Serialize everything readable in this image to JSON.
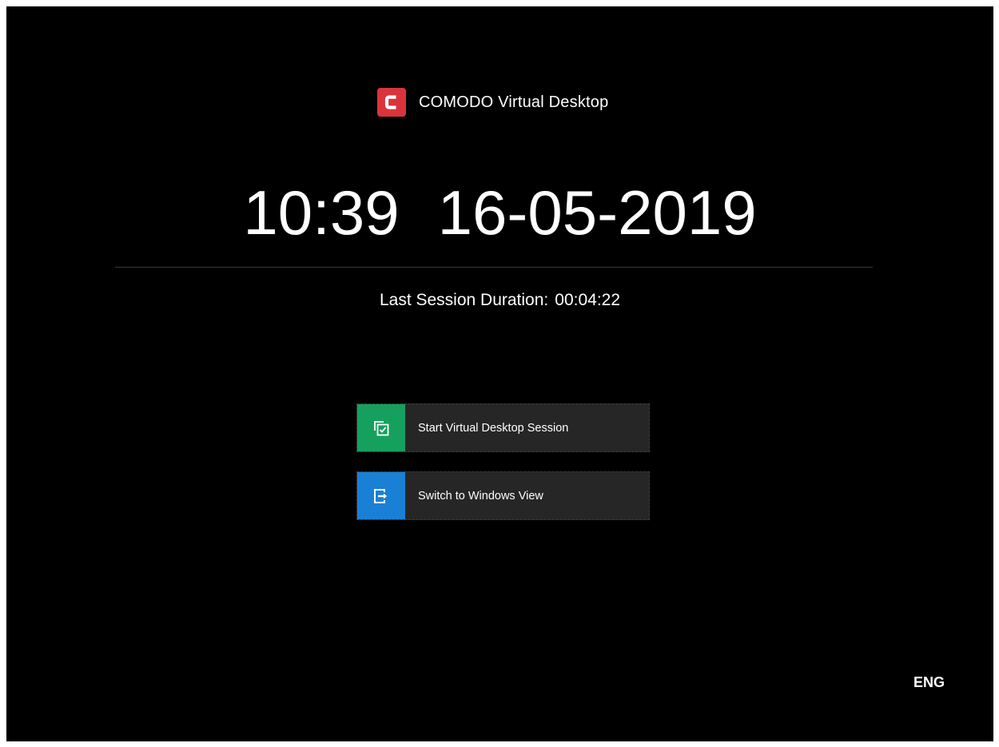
{
  "brand": {
    "logo_letter": "C",
    "logo_color": "#d9343b",
    "title": "COMODO Virtual Desktop"
  },
  "clock": {
    "time": "10:39",
    "date": "16-05-2019"
  },
  "session": {
    "label": "Last Session Duration:",
    "duration": "00:04:22"
  },
  "actions": [
    {
      "label": "Start Virtual Desktop Session",
      "icon": "window-check-icon",
      "color": "#16a05d"
    },
    {
      "label": "Switch to Windows View",
      "icon": "switch-view-icon",
      "color": "#1a80d6"
    }
  ],
  "language": "ENG"
}
